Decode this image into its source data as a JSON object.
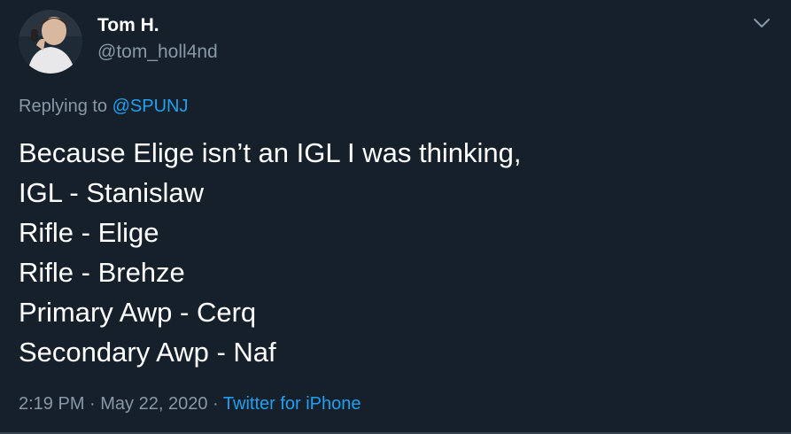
{
  "user": {
    "display_name": "Tom H.",
    "handle": "@tom_holl4nd"
  },
  "reply": {
    "prefix": "Replying to",
    "mention": "@SPUNJ"
  },
  "tweet": {
    "lines": [
      "Because Elige isn’t an IGL I was thinking,",
      "IGL - Stanislaw",
      "Rifle - Elige",
      "Rifle - Brehze",
      "Primary Awp - Cerq",
      "Secondary Awp - Naf"
    ]
  },
  "meta": {
    "time": "2:19 PM",
    "sep1": " · ",
    "date": "May 22, 2020",
    "sep2": " · ",
    "source": "Twitter for iPhone"
  },
  "icons": {
    "more": "chevron-down-icon"
  },
  "colors": {
    "background": "#15202b",
    "primary_text": "#ffffff",
    "secondary_text": "#8899a6",
    "accent": "#1da1f2"
  }
}
